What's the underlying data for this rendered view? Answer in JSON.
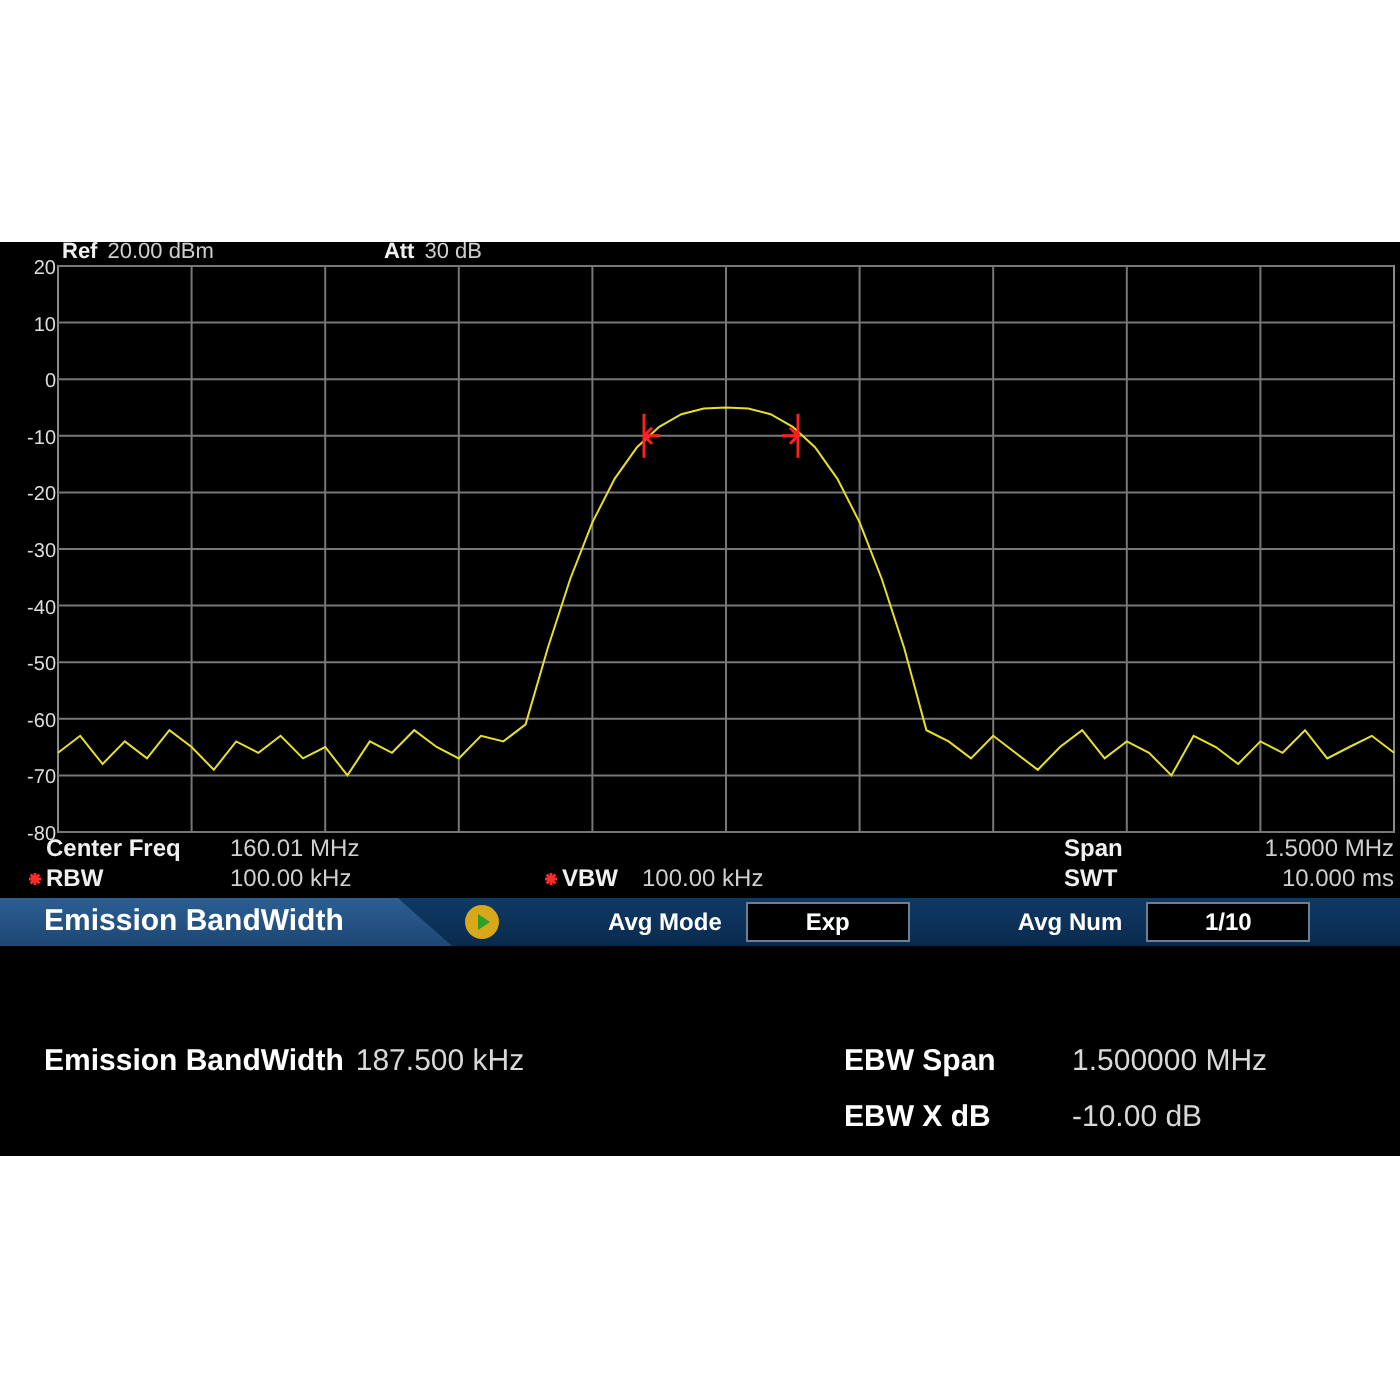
{
  "header": {
    "ref_label": "Ref",
    "ref_value": "20.00 dBm",
    "att_label": "Att",
    "att_value": "30 dB"
  },
  "chart_data": {
    "type": "line",
    "grid": true,
    "ylim": [
      -80,
      20
    ],
    "yticks": [
      20,
      10,
      0,
      -10,
      -20,
      -30,
      -40,
      -50,
      -60,
      -70,
      -80
    ],
    "series": [
      {
        "color": "#e6e02a",
        "values": [
          -66,
          -63,
          -68,
          -64,
          -67,
          -62,
          -65,
          -69,
          -64,
          -66,
          -63,
          -67,
          -65,
          -70,
          -64,
          -66,
          -62,
          -65,
          -67,
          -63,
          -64,
          -61,
          -47.5,
          -35.3,
          -25.3,
          -17.6,
          -12,
          -8.4,
          -6.2,
          -5.2,
          -5,
          -5.2,
          -6.2,
          -8.4,
          -12,
          -17.6,
          -25.3,
          -35.3,
          -47.5,
          -62,
          -64,
          -67,
          -63,
          -66,
          -69,
          -65,
          -62,
          -67,
          -64,
          -66,
          -70,
          -63,
          -65,
          -68,
          -64,
          -66,
          -62,
          -67,
          -65,
          -63,
          -66
        ]
      }
    ]
  },
  "info_rows": [
    {
      "left": {
        "label": "Center Freq",
        "value": "160.01 MHz",
        "manual": false
      },
      "right": {
        "label": "Span",
        "value": "1.5000 MHz"
      }
    },
    {
      "left": {
        "label": "RBW",
        "value": "100.00 kHz",
        "manual": true
      },
      "middle": {
        "label": "VBW",
        "value": "100.00 kHz",
        "manual": true
      },
      "right": {
        "label": "SWT",
        "value": "10.000 ms"
      }
    }
  ],
  "menu": {
    "title": "Emission BandWidth",
    "fields": [
      {
        "label": "Avg Mode",
        "value": "Exp"
      },
      {
        "label": "Avg Num",
        "value": "1/10"
      }
    ]
  },
  "results": {
    "left": [
      {
        "label": "Emission BandWidth",
        "value": "187.500 kHz"
      }
    ],
    "right": [
      {
        "label": "EBW Span",
        "value": "1.500000 MHz"
      },
      {
        "label": "EBW X dB",
        "value": "-10.00 dB"
      }
    ]
  }
}
